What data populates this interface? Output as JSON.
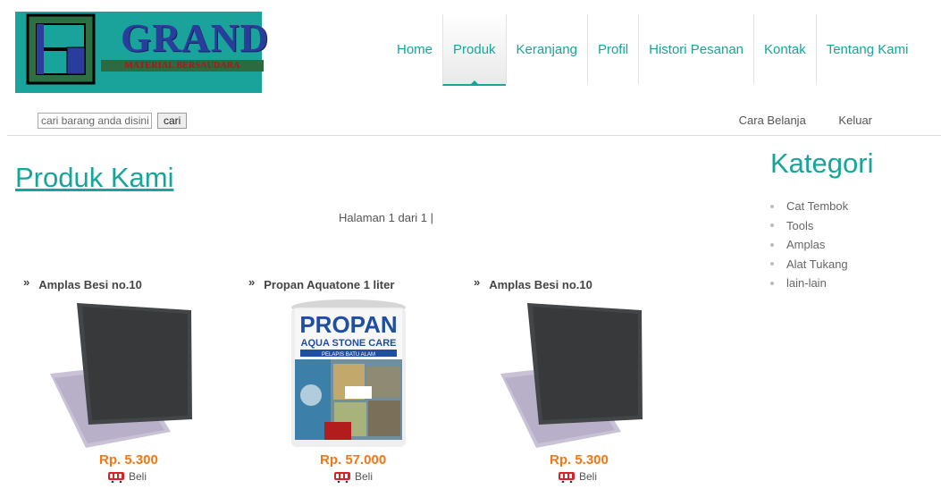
{
  "brand": {
    "name": "GRAND",
    "tagline": "MATERIAL BERSAUDARA",
    "colors": {
      "accent": "#17a59a",
      "logo_bg": "#1aa39a",
      "price": "#f07818"
    }
  },
  "nav": {
    "items": [
      {
        "label": "Home"
      },
      {
        "label": "Produk",
        "active": true
      },
      {
        "label": "Keranjang"
      },
      {
        "label": "Profil"
      },
      {
        "label": "Histori Pesanan"
      },
      {
        "label": "Kontak"
      },
      {
        "label": "Tentang Kami"
      }
    ]
  },
  "search": {
    "placeholder": "cari barang anda disini",
    "button_label": "cari"
  },
  "toplinks": {
    "cara_belanja": "Cara Belanja",
    "keluar": "Keluar"
  },
  "main": {
    "title": "Produk Kami",
    "paging": "Halaman 1 dari 1 |",
    "products": [
      {
        "name": "Amplas Besi no.10",
        "price": "Rp. 5.300",
        "buy_label": "Beli",
        "image": "sandpaper"
      },
      {
        "name": "Propan Aquatone 1 liter",
        "price": "Rp. 57.000",
        "buy_label": "Beli",
        "image": "paint-can"
      },
      {
        "name": "Amplas Besi no.10",
        "price": "Rp. 5.300",
        "buy_label": "Beli",
        "image": "sandpaper"
      }
    ],
    "raquo": "»"
  },
  "sidebar": {
    "title": "Kategori",
    "categories": [
      "Cat Tembok",
      "Tools",
      "Amplas",
      "Alat Tukang",
      "lain-lain"
    ]
  },
  "can_label": {
    "line1": "PROPAN",
    "line2": "AQUA STONE CARE",
    "line3": "PELAPIS BATU ALAM"
  }
}
